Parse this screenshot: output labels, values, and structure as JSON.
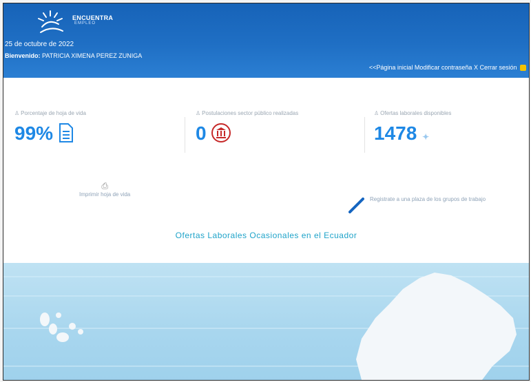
{
  "header": {
    "logo_title": "ENCUENTRA",
    "logo_subtitle": "EMPLEO",
    "date": "25 de octubre de 2022",
    "user_label": "Bienvenido:",
    "user_name": "PATRICIA XIMENA PEREZ ZUNIGA",
    "links": {
      "home": "<<Página inicial",
      "change_password": "Modificar contraseña",
      "logout": "X Cerrar sesión"
    }
  },
  "stats": [
    {
      "label": "Porcentaje de hoja de vida",
      "value": "99%",
      "icon": "document-icon"
    },
    {
      "label": "Postulaciones sector público realizadas",
      "value": "0",
      "icon": "institution-icon"
    },
    {
      "label": "Ofertas laborales disponibles",
      "value": "1478",
      "icon": "sparkle-icon"
    }
  ],
  "actions": {
    "resume": "Imprimir hoja de vida",
    "register_group": "Registrate a una plaza de los grupos de trabajo"
  },
  "section_title": "Ofertas Laborales Ocasionales en el Ecuador",
  "colors": {
    "header_blue": "#1f6fc4",
    "accent_blue": "#1e88e5",
    "title_cyan": "#1ea3c9",
    "map_sea": "#a8d6ee"
  }
}
